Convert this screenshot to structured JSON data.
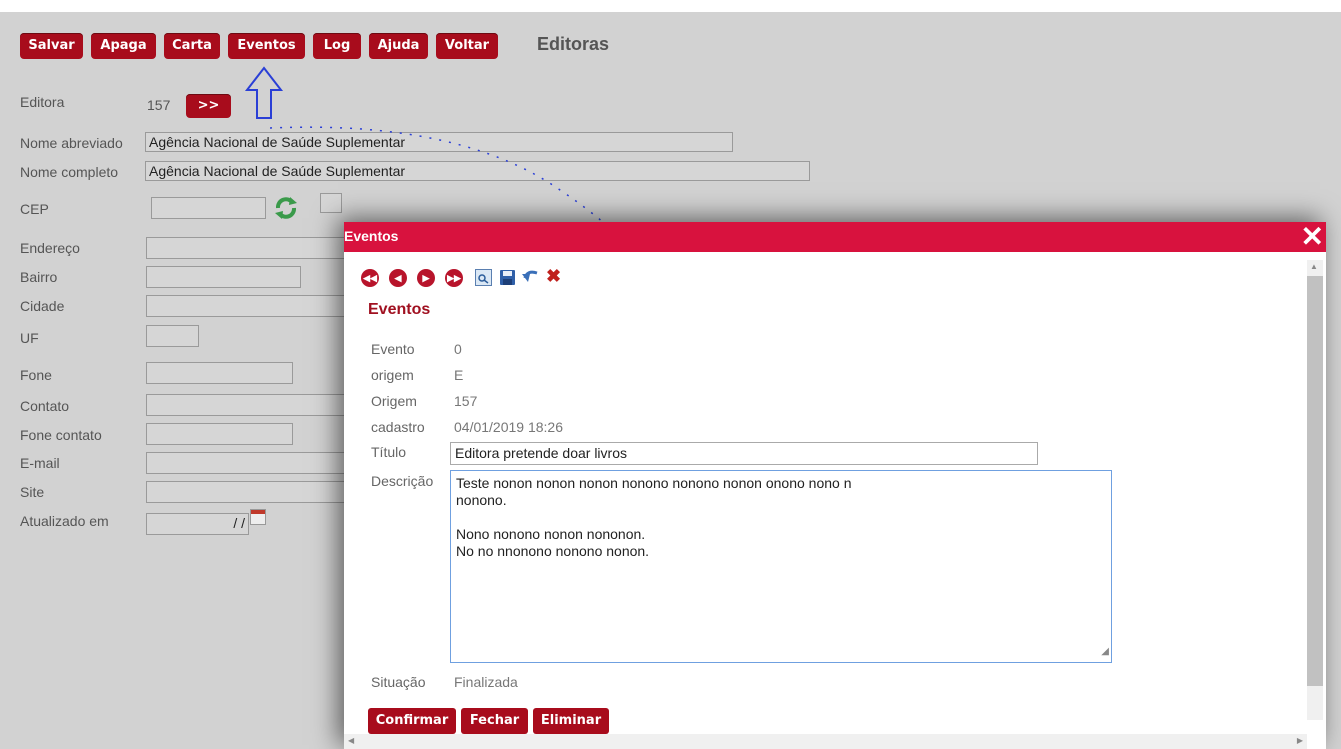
{
  "toolbar": {
    "buttons": [
      "Salvar",
      "Apaga",
      "Carta",
      "Eventos",
      "Log",
      "Ajuda",
      "Voltar"
    ],
    "page_title": "Editoras"
  },
  "form": {
    "editora_label": "Editora",
    "editora_value": "157",
    "next_button": ">>",
    "nome_abreviado_label": "Nome abreviado",
    "nome_abreviado_value": "Agência Nacional de Saúde Suplementar",
    "nome_completo_label": "Nome completo",
    "nome_completo_value": "Agência Nacional de Saúde Suplementar",
    "cep_label": "CEP",
    "endereco_label": "Endereço",
    "bairro_label": "Bairro",
    "cidade_label": "Cidade",
    "uf_label": "UF",
    "fone_label": "Fone",
    "contato_label": "Contato",
    "fone_contato_label": "Fone contato",
    "email_label": "E-mail",
    "site_label": "Site",
    "atualizado_label": "Atualizado em",
    "atualizado_value": "/ /"
  },
  "modal": {
    "title": "Eventos",
    "close": "✕",
    "heading": "Eventos",
    "evento_label": "Evento",
    "evento_value": "0",
    "origem_lc_label": "origem",
    "origem_lc_value": "E",
    "origem_label": "Origem",
    "origem_value": "157",
    "cadastro_label": "cadastro",
    "cadastro_value": "04/01/2019 18:26",
    "titulo_label": "Título",
    "titulo_value": "Editora pretende doar livros",
    "descricao_label": "Descrição",
    "descricao_lines": [
      "Teste nonon nonon nonon nonono nonono nonon onono nono n",
      "nonono.",
      "",
      "Nono  nonono nonon nononon.",
      "No no nnonono nonono nonon."
    ],
    "situacao_label": "Situação",
    "situacao_value": "Finalizada",
    "buttons": [
      "Confirmar",
      "Fechar",
      "Eliminar"
    ]
  },
  "colors": {
    "button_red": "#a80c1c",
    "modal_header": "#d8123e",
    "annotation_blue": "#2a3fd6"
  }
}
